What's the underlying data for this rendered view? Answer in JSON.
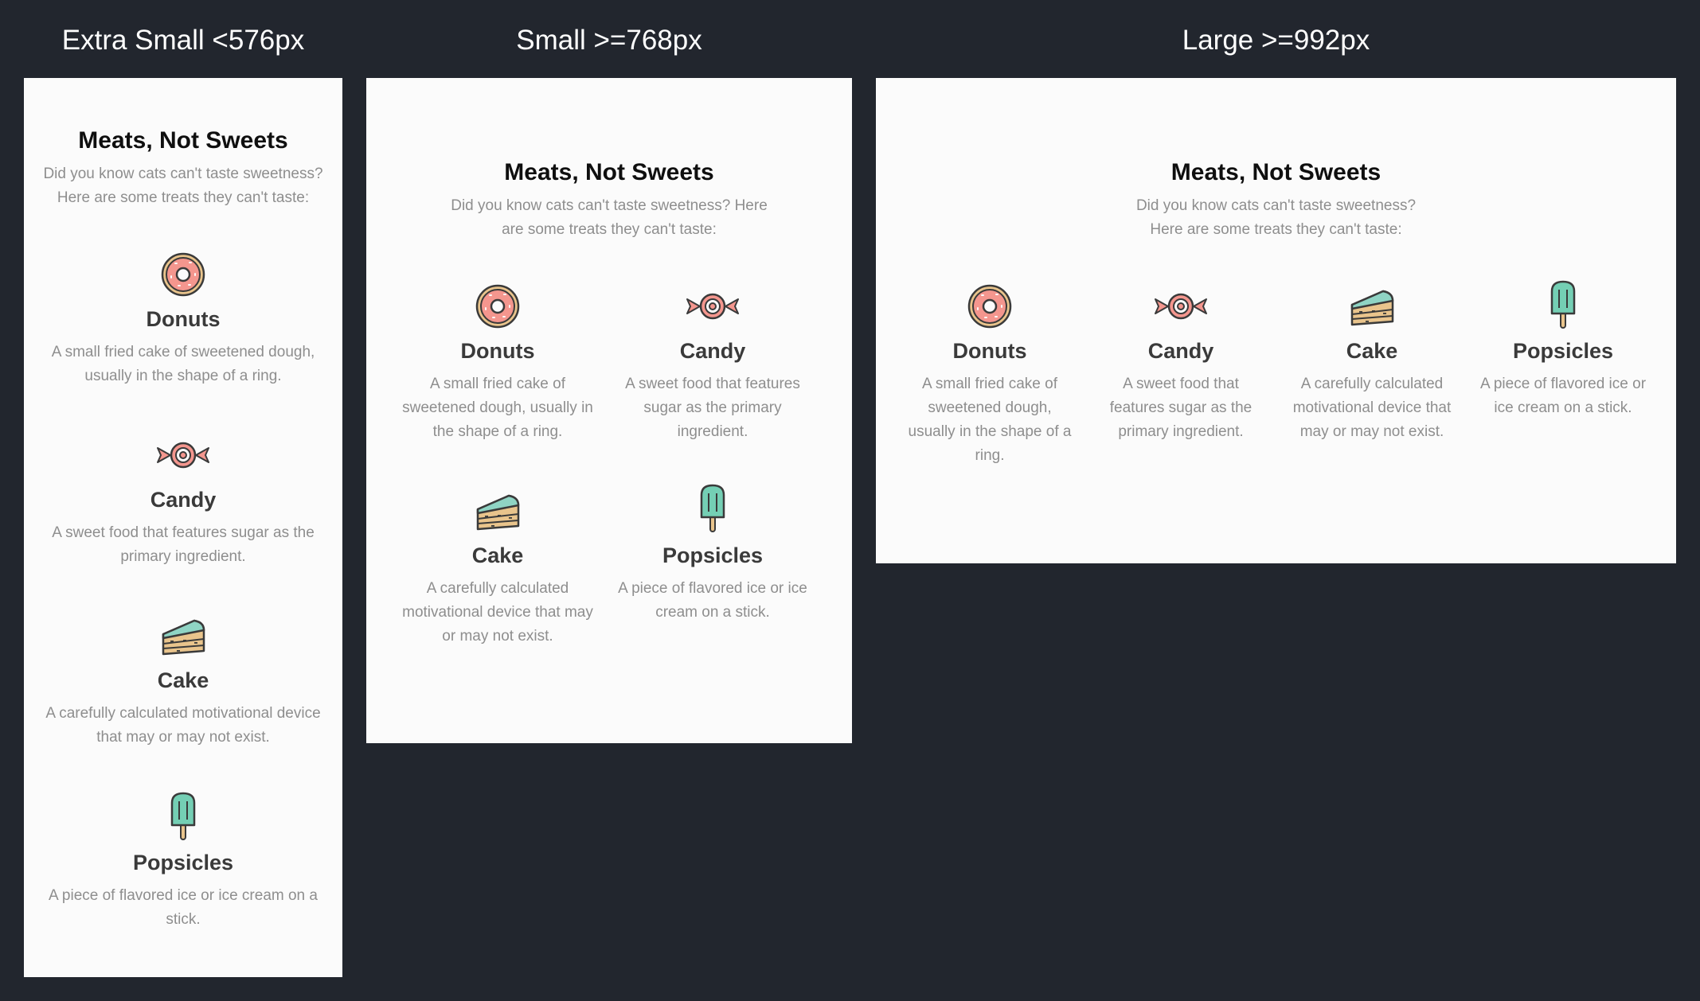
{
  "colors": {
    "background": "#22262e",
    "panel": "#fbfbfb",
    "donut_frosting": "#f4968e",
    "candy": "#f4968e",
    "cake_frosting": "#8fd4c4",
    "cake_base": "#e9c48c",
    "popsicle": "#74cfb4",
    "stroke": "#3a3a3a"
  },
  "breakpoints": [
    {
      "label": "Extra Small <576px"
    },
    {
      "label": "Small >=768px"
    },
    {
      "label": "Large >=992px"
    }
  ],
  "content": {
    "title": "Meats, Not Sweets",
    "intro_line1": "Did you know cats can't taste sweetness?",
    "intro_line2": "Here are some treats they can't taste:",
    "intro_sm_line1": "Did you know cats can't taste sweetness? Here",
    "intro_sm_line2": "are some treats they can't taste:",
    "items": [
      {
        "name": "Donuts",
        "icon": "donut-icon",
        "desc_xs": [
          "A small fried cake of sweetened dough,",
          "usually in the shape of a ring."
        ],
        "desc_sm": [
          "A small fried cake of",
          "sweetened dough, usually in",
          "the shape of a ring."
        ],
        "desc_lg": [
          "A small fried cake of",
          "sweetened dough,",
          "usually in the shape of a",
          "ring."
        ]
      },
      {
        "name": "Candy",
        "icon": "candy-icon",
        "desc_xs": [
          "A sweet food that features sugar as the",
          "primary ingredient."
        ],
        "desc_sm": [
          "A sweet food that features",
          "sugar as the primary",
          "ingredient."
        ],
        "desc_lg": [
          "A sweet food that",
          "features sugar as the",
          "primary ingredient."
        ]
      },
      {
        "name": "Cake",
        "icon": "cake-icon",
        "desc_xs": [
          "A carefully calculated motivational device",
          "that may or may not exist."
        ],
        "desc_sm": [
          "A carefully calculated",
          "motivational device that may",
          "or may not exist."
        ],
        "desc_lg": [
          "A carefully calculated",
          "motivational device that",
          "may or may not exist."
        ]
      },
      {
        "name": "Popsicles",
        "icon": "popsicle-icon",
        "desc_xs": [
          "A piece of flavored ice or ice cream on a",
          "stick."
        ],
        "desc_sm": [
          "A piece of flavored ice or ice",
          "cream on a stick."
        ],
        "desc_lg": [
          "A piece of flavored ice or",
          "ice cream on a stick."
        ]
      }
    ]
  }
}
